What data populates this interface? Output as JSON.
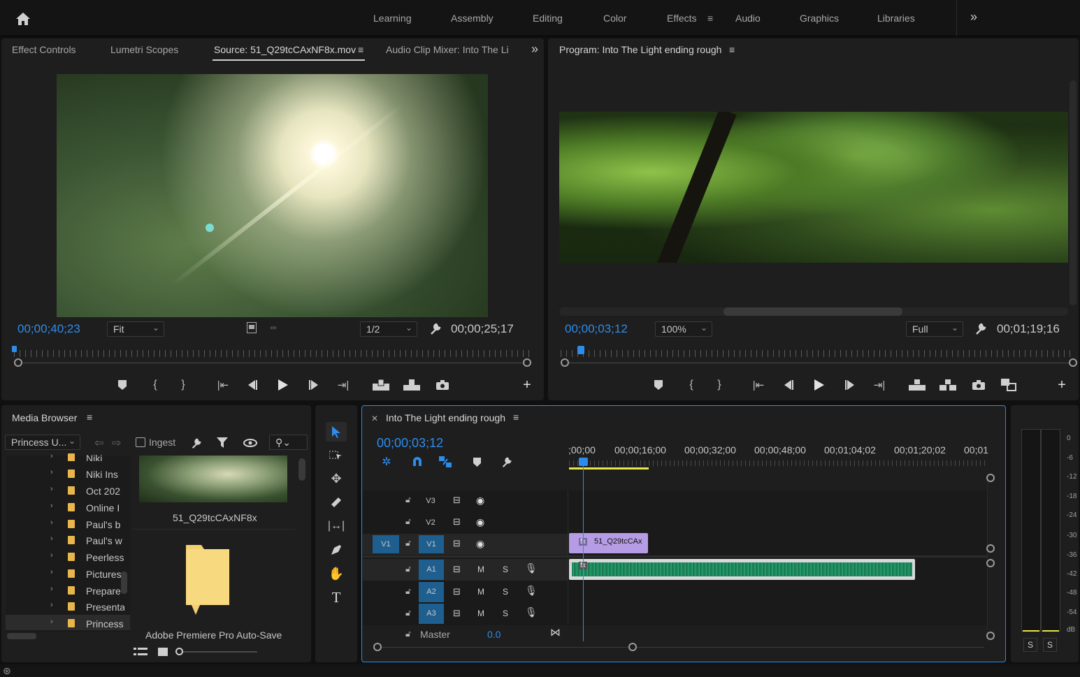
{
  "workspaces": {
    "items": [
      "Learning",
      "Assembly",
      "Editing",
      "Color",
      "Effects",
      "Audio",
      "Graphics",
      "Libraries"
    ],
    "active": "Effects"
  },
  "source_panel": {
    "tabs": [
      "Effect Controls",
      "Lumetri Scopes",
      "Source: 51_Q29tcCAxNF8x.mov",
      "Audio Clip Mixer: Into The Li"
    ],
    "timecode": "00;00;40;23",
    "zoom": "Fit",
    "resolution": "1/2",
    "duration": "00;00;25;17"
  },
  "program_panel": {
    "title": "Program: Into The Light ending rough",
    "timecode": "00;00;03;12",
    "zoom": "100%",
    "resolution": "Full",
    "duration": "00;01;19;16"
  },
  "media_browser": {
    "title": "Media Browser",
    "location": "Princess U...",
    "ingest_label": "Ingest",
    "folders": [
      "Niki",
      "Niki Ins",
      "Oct 202",
      "Online I",
      "Paul's b",
      "Paul's w",
      "Peerless",
      "Pictures",
      "Prepare",
      "Presenta",
      "Princess"
    ],
    "thumb_label": "51_Q29tcCAxNF8x",
    "folder_label": "Adobe Premiere Pro Auto-Save"
  },
  "timeline": {
    "title": "Into The Light ending rough",
    "timecode": "00;00;03;12",
    "ruler_labels": [
      ";00;00",
      "00;00;16;00",
      "00;00;32;00",
      "00;00;48;00",
      "00;01;04;02",
      "00;01;20;02",
      "00;01"
    ],
    "video_tracks": [
      "V3",
      "V2",
      "V1"
    ],
    "source_patch_video": "V1",
    "audio_tracks": [
      "A1",
      "A2",
      "A3"
    ],
    "mute_label": "M",
    "solo_label": "S",
    "master_label": "Master",
    "master_value": "0.0",
    "clip_label": "51_Q29tcCAx",
    "fx_label": "fx"
  },
  "audio_meter": {
    "scale": [
      "0",
      "-6",
      "-12",
      "-18",
      "-24",
      "-30",
      "-36",
      "-42",
      "-48",
      "-54",
      "dB"
    ],
    "solo_buttons": [
      "S",
      "S"
    ]
  },
  "colors": {
    "accent": "#2d8ceb",
    "video_clip": "#b69ce4",
    "audio_clip": "#1f8a5f",
    "workarea": "#e8e64a"
  }
}
